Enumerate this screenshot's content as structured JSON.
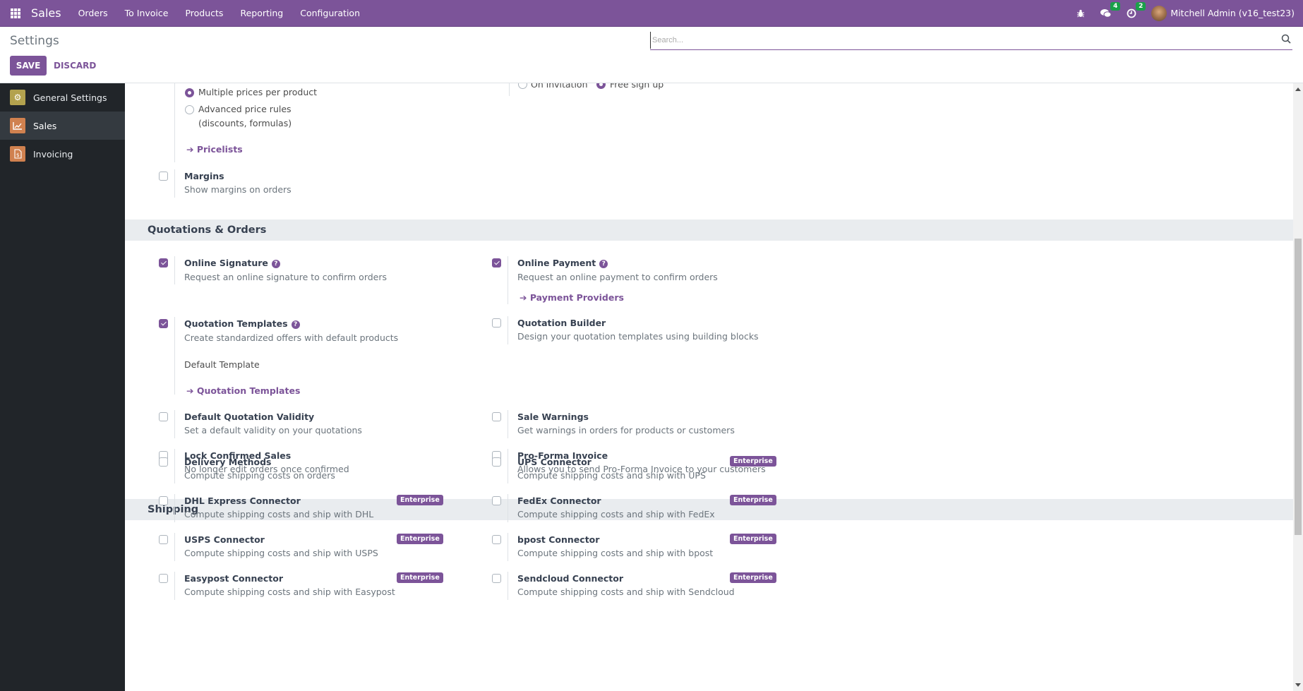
{
  "navbar": {
    "app_name": "Sales",
    "menu": [
      "Orders",
      "To Invoice",
      "Products",
      "Reporting",
      "Configuration"
    ],
    "messages_count": "4",
    "activities_count": "2",
    "user_name": "Mitchell Admin (v16_test23)"
  },
  "control_panel": {
    "breadcrumb": "Settings",
    "save_label": "SAVE",
    "discard_label": "DISCARD",
    "search_placeholder": "Search..."
  },
  "sidebar": {
    "items": [
      {
        "label": "General Settings",
        "icon": "gear-icon",
        "color": "#b3a24e"
      },
      {
        "label": "Sales",
        "icon": "chart-icon",
        "color": "#d0814f",
        "active": true
      },
      {
        "label": "Invoicing",
        "icon": "invoice-icon",
        "color": "#d0814f"
      }
    ]
  },
  "pricing": {
    "radio_multiple": "Multiple prices per product",
    "radio_advanced": "Advanced price rules",
    "radio_advanced_sub": "(discounts, formulas)",
    "pricelists_link": "Pricelists",
    "margins_title": "Margins",
    "margins_desc": "Show margins on orders",
    "signup_on_invitation": "On invitation",
    "signup_free": "Free sign up"
  },
  "quotations": {
    "section_title": "Quotations & Orders",
    "online_signature": {
      "title": "Online Signature",
      "desc": "Request an online signature to confirm orders",
      "checked": true
    },
    "online_payment": {
      "title": "Online Payment",
      "desc": "Request an online payment to confirm orders",
      "link": "Payment Providers",
      "checked": true
    },
    "quotation_templates": {
      "title": "Quotation Templates",
      "desc": "Create standardized offers with default products",
      "field_label": "Default Template",
      "link": "Quotation Templates",
      "checked": true
    },
    "quotation_builder": {
      "title": "Quotation Builder",
      "desc": "Design your quotation templates using building blocks",
      "checked": false
    },
    "default_validity": {
      "title": "Default Quotation Validity",
      "desc": "Set a default validity on your quotations",
      "checked": false
    },
    "sale_warnings": {
      "title": "Sale Warnings",
      "desc": "Get warnings in orders for products or customers",
      "checked": false
    },
    "lock_confirmed": {
      "title": "Lock Confirmed Sales",
      "desc": "No longer edit orders once confirmed",
      "checked": false
    },
    "proforma": {
      "title": "Pro-Forma Invoice",
      "desc": "Allows you to send Pro-Forma Invoice to your customers",
      "checked": false
    }
  },
  "shipping": {
    "section_title": "Shipping",
    "enterprise_label": "Enterprise",
    "left": [
      {
        "title": "Delivery Methods",
        "desc": "Compute shipping costs on orders",
        "enterprise": false
      },
      {
        "title": "DHL Express Connector",
        "desc": "Compute shipping costs and ship with DHL",
        "enterprise": true
      },
      {
        "title": "USPS Connector",
        "desc": "Compute shipping costs and ship with USPS",
        "enterprise": true
      },
      {
        "title": "Easypost Connector",
        "desc": "Compute shipping costs and ship with Easypost",
        "enterprise": true
      }
    ],
    "right": [
      {
        "title": "UPS Connector",
        "desc": "Compute shipping costs and ship with UPS",
        "enterprise": true
      },
      {
        "title": "FedEx Connector",
        "desc": "Compute shipping costs and ship with FedEx",
        "enterprise": true
      },
      {
        "title": "bpost Connector",
        "desc": "Compute shipping costs and ship with bpost",
        "enterprise": true
      },
      {
        "title": "Sendcloud Connector",
        "desc": "Compute shipping costs and ship with Sendcloud",
        "enterprise": true
      }
    ]
  },
  "colors": {
    "brand": "#7c5499",
    "badge": "#1aa049"
  }
}
